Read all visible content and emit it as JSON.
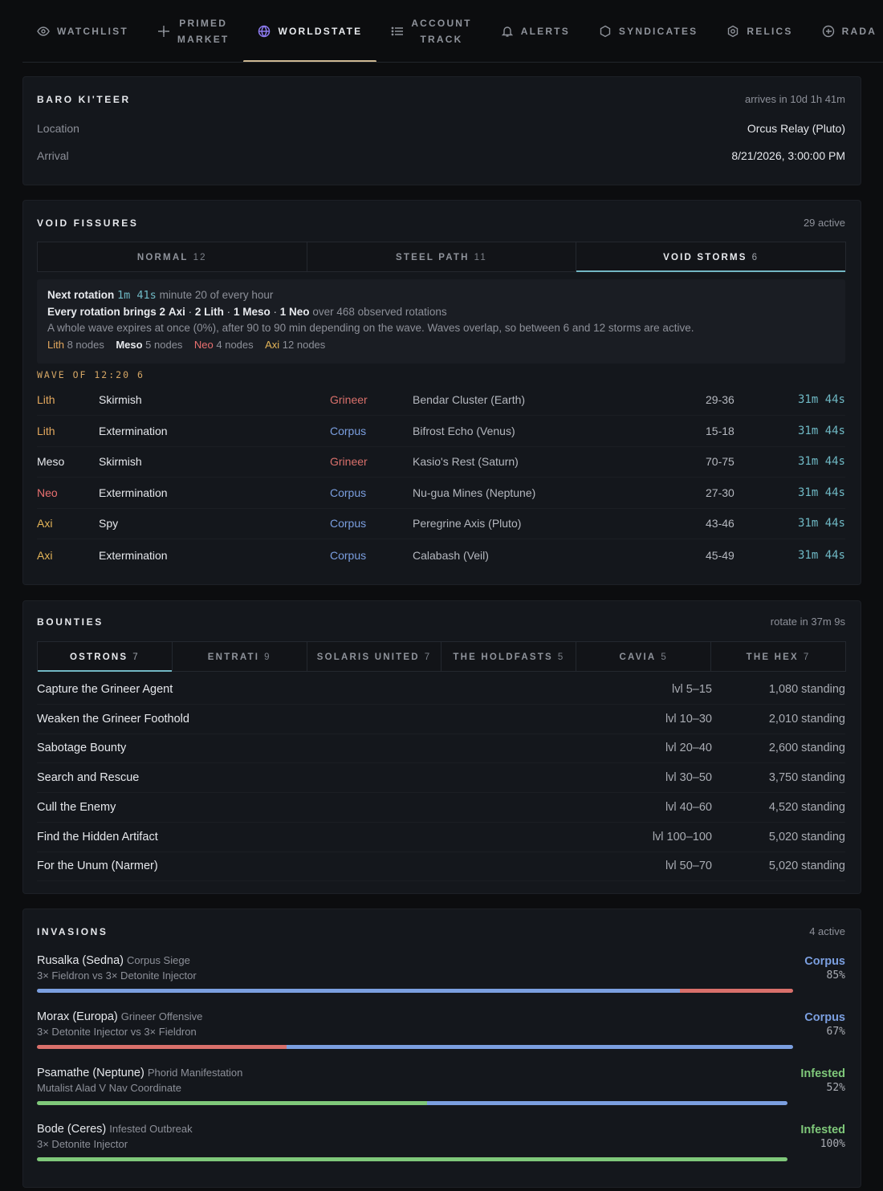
{
  "nav": {
    "items": [
      {
        "label": "WATCHLIST",
        "icon": "eye-icon",
        "active": false
      },
      {
        "label": [
          "PRIMED",
          "MARKET"
        ],
        "icon": "sparkle-icon",
        "active": false
      },
      {
        "label": "WORLDSTATE",
        "icon": "globe-icon",
        "active": true
      },
      {
        "label": [
          "ACCOUNT",
          "TRACK"
        ],
        "icon": "list-icon",
        "active": false
      },
      {
        "label": "ALERTS",
        "icon": "bell-icon",
        "active": false
      },
      {
        "label": "SYNDICATES",
        "icon": "hexagon-icon",
        "active": false
      },
      {
        "label": "RELICS",
        "icon": "relic-icon",
        "active": false
      },
      {
        "label": "RADA",
        "icon": "radar-icon",
        "active": false
      }
    ]
  },
  "baro": {
    "title": "BARO KI'TEER",
    "arrives": "arrives in 10d 1h 41m",
    "location_label": "Location",
    "location_value": "Orcus Relay (Pluto)",
    "arrival_label": "Arrival",
    "arrival_value": "8/21/2026, 3:00:00 PM"
  },
  "fissures": {
    "title": "VOID FISSURES",
    "active": "29 active",
    "tabs": [
      {
        "label": "NORMAL",
        "count": "12",
        "active": false
      },
      {
        "label": "STEEL PATH",
        "count": "11",
        "active": false
      },
      {
        "label": "VOID STORMS",
        "count": "6",
        "active": true
      }
    ],
    "info": {
      "next_label": "Next rotation",
      "next_timer": "1m 41s",
      "next_suffix": "minute 20 of every hour",
      "every_label": "Every rotation brings",
      "every_parts": [
        "2",
        "Axi",
        "·",
        "2",
        "Lith",
        "·",
        "1",
        "Meso",
        "·",
        "1",
        "Neo"
      ],
      "every_suffix": "over 468 observed rotations",
      "line3": "A whole wave expires at once (0%), after 90 to 90 min depending on the wave. Waves overlap, so between 6 and 12 storms are active.",
      "nodes": [
        {
          "tier": "Lith",
          "text": "8 nodes"
        },
        {
          "tier": "Meso",
          "text": "5 nodes"
        },
        {
          "tier": "Neo",
          "text": "4 nodes"
        },
        {
          "tier": "Axi",
          "text": "12 nodes"
        }
      ]
    },
    "wave_label": "WAVE OF 12:20",
    "wave_count": "6",
    "rows": [
      {
        "tier": "Lith",
        "mission": "Skirmish",
        "faction": "Grineer",
        "node": "Bendar Cluster (Earth)",
        "level": "29-36",
        "timer": "31m 44s"
      },
      {
        "tier": "Lith",
        "mission": "Extermination",
        "faction": "Corpus",
        "node": "Bifrost Echo (Venus)",
        "level": "15-18",
        "timer": "31m 44s"
      },
      {
        "tier": "Meso",
        "mission": "Skirmish",
        "faction": "Grineer",
        "node": "Kasio's Rest (Saturn)",
        "level": "70-75",
        "timer": "31m 44s"
      },
      {
        "tier": "Neo",
        "mission": "Extermination",
        "faction": "Corpus",
        "node": "Nu-gua Mines (Neptune)",
        "level": "27-30",
        "timer": "31m 44s"
      },
      {
        "tier": "Axi",
        "mission": "Spy",
        "faction": "Corpus",
        "node": "Peregrine Axis (Pluto)",
        "level": "43-46",
        "timer": "31m 44s"
      },
      {
        "tier": "Axi",
        "mission": "Extermination",
        "faction": "Corpus",
        "node": "Calabash (Veil)",
        "level": "45-49",
        "timer": "31m 44s"
      }
    ]
  },
  "bounties": {
    "title": "BOUNTIES",
    "rotate": "rotate in 37m 9s",
    "tabs": [
      {
        "label": "OSTRONS",
        "count": "7",
        "active": true
      },
      {
        "label": "ENTRATI",
        "count": "9",
        "active": false
      },
      {
        "label": "SOLARIS UNITED",
        "count": "7",
        "active": false
      },
      {
        "label": "THE HOLDFASTS",
        "count": "5",
        "active": false
      },
      {
        "label": "CAVIA",
        "count": "5",
        "active": false
      },
      {
        "label": "THE HEX",
        "count": "7",
        "active": false
      }
    ],
    "rows": [
      {
        "name": "Capture the Grineer Agent",
        "level": "lvl 5–15",
        "standing": "1,080 standing"
      },
      {
        "name": "Weaken the Grineer Foothold",
        "level": "lvl 10–30",
        "standing": "2,010 standing"
      },
      {
        "name": "Sabotage Bounty",
        "level": "lvl 20–40",
        "standing": "2,600 standing"
      },
      {
        "name": "Search and Rescue",
        "level": "lvl 30–50",
        "standing": "3,750 standing"
      },
      {
        "name": "Cull the Enemy",
        "level": "lvl 40–60",
        "standing": "4,520 standing"
      },
      {
        "name": "Find the Hidden Artifact",
        "level": "lvl 100–100",
        "standing": "5,020 standing"
      },
      {
        "name": "For the Unum (Narmer)",
        "level": "lvl 50–70",
        "standing": "5,020 standing"
      }
    ]
  },
  "invasions": {
    "title": "INVASIONS",
    "active": "4 active",
    "items": [
      {
        "node": "Rusalka (Sedna)",
        "type": "Corpus Siege",
        "reward": "3× Fieldron vs 3× Detonite Injector",
        "winner": "Corpus",
        "percent": "85%",
        "progress": 0.85,
        "color_a": "corpus",
        "color_b": "grineer",
        "bar_end": 0.0
      },
      {
        "node": "Morax (Europa)",
        "type": "Grineer Offensive",
        "reward": "3× Detonite Injector vs 3× Fieldron",
        "winner": "Corpus",
        "percent": "67%",
        "progress": 0.33,
        "color_a": "grineer",
        "color_b": "corpus",
        "bar_end": 0.0
      },
      {
        "node": "Psamathe (Neptune)",
        "type": "Phorid Manifestation",
        "reward": "Mutalist Alad V Nav Coordinate",
        "winner": "Infested",
        "percent": "52%",
        "progress": 0.52,
        "color_a": "infested",
        "color_b": "corpus",
        "bar_end": 0.0
      },
      {
        "node": "Bode (Ceres)",
        "type": "Infested Outbreak",
        "reward": "3× Detonite Injector",
        "winner": "Infested",
        "percent": "100%",
        "progress": 1.0,
        "color_a": "infested",
        "color_b": "infested",
        "bar_end": 0.0
      }
    ]
  },
  "colors": {
    "grineer": "#d9706b",
    "corpus": "#7b9fe0",
    "infested": "#7fc87a",
    "teal_accent": "#72b7c4",
    "nav_active_underline": "#cdb892"
  }
}
